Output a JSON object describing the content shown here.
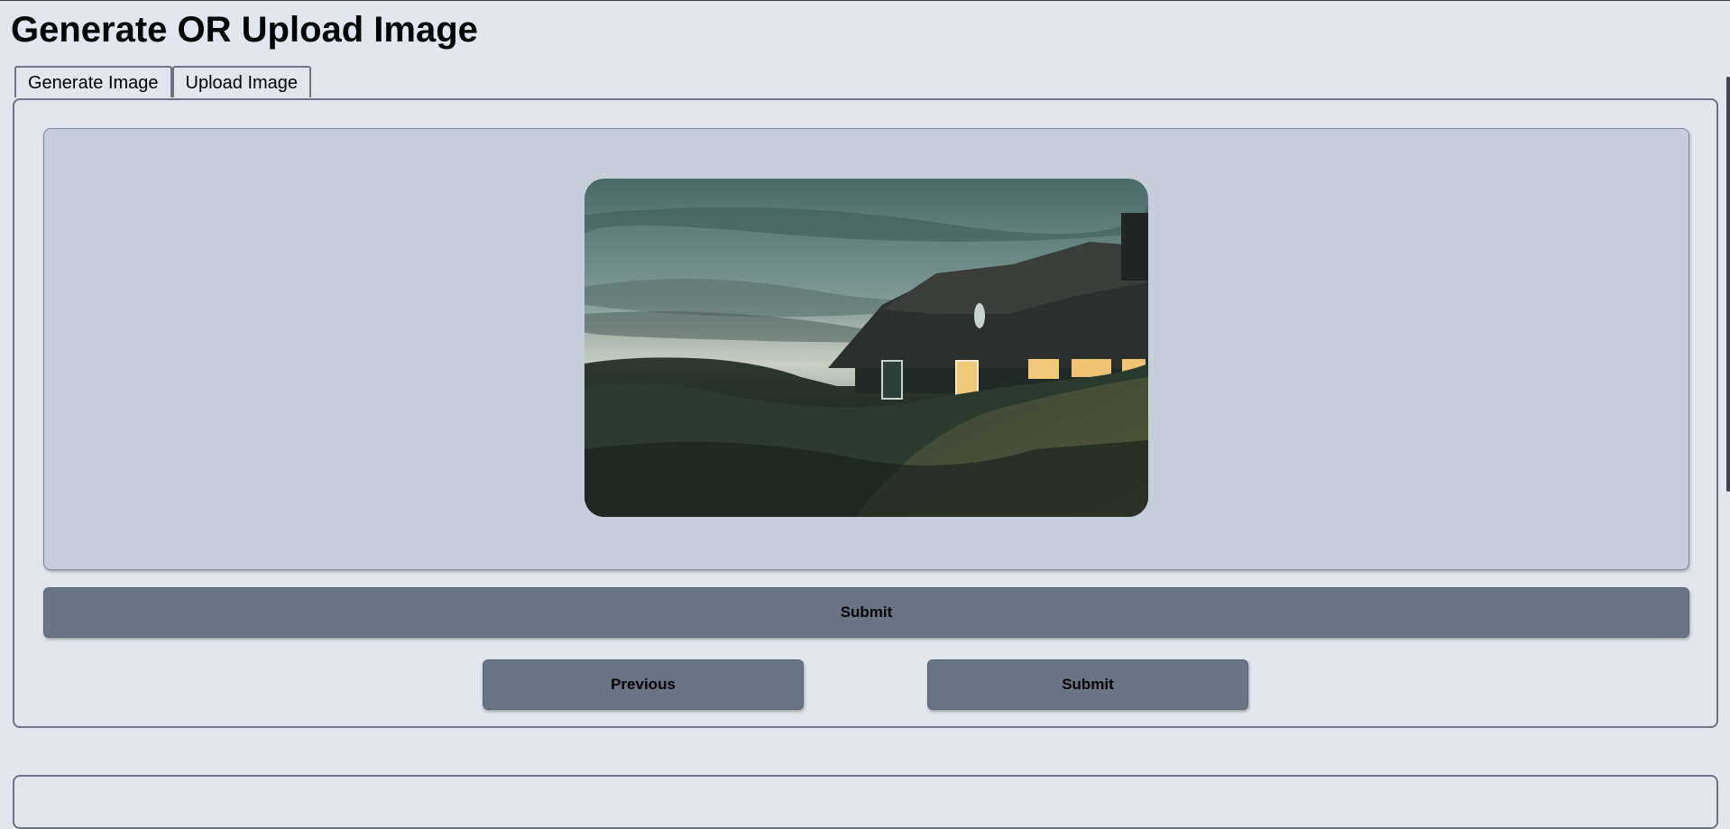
{
  "page": {
    "title": "Generate OR Upload Image"
  },
  "tabs": [
    {
      "label": "Generate Image"
    },
    {
      "label": "Upload Image"
    }
  ],
  "buttons": {
    "submit_wide": "Submit",
    "previous": "Previous",
    "submit": "Submit"
  },
  "colors": {
    "background": "#e1e6ef",
    "image_area": "#c5cfdb",
    "button": "#697487",
    "border": "#6b7587"
  }
}
